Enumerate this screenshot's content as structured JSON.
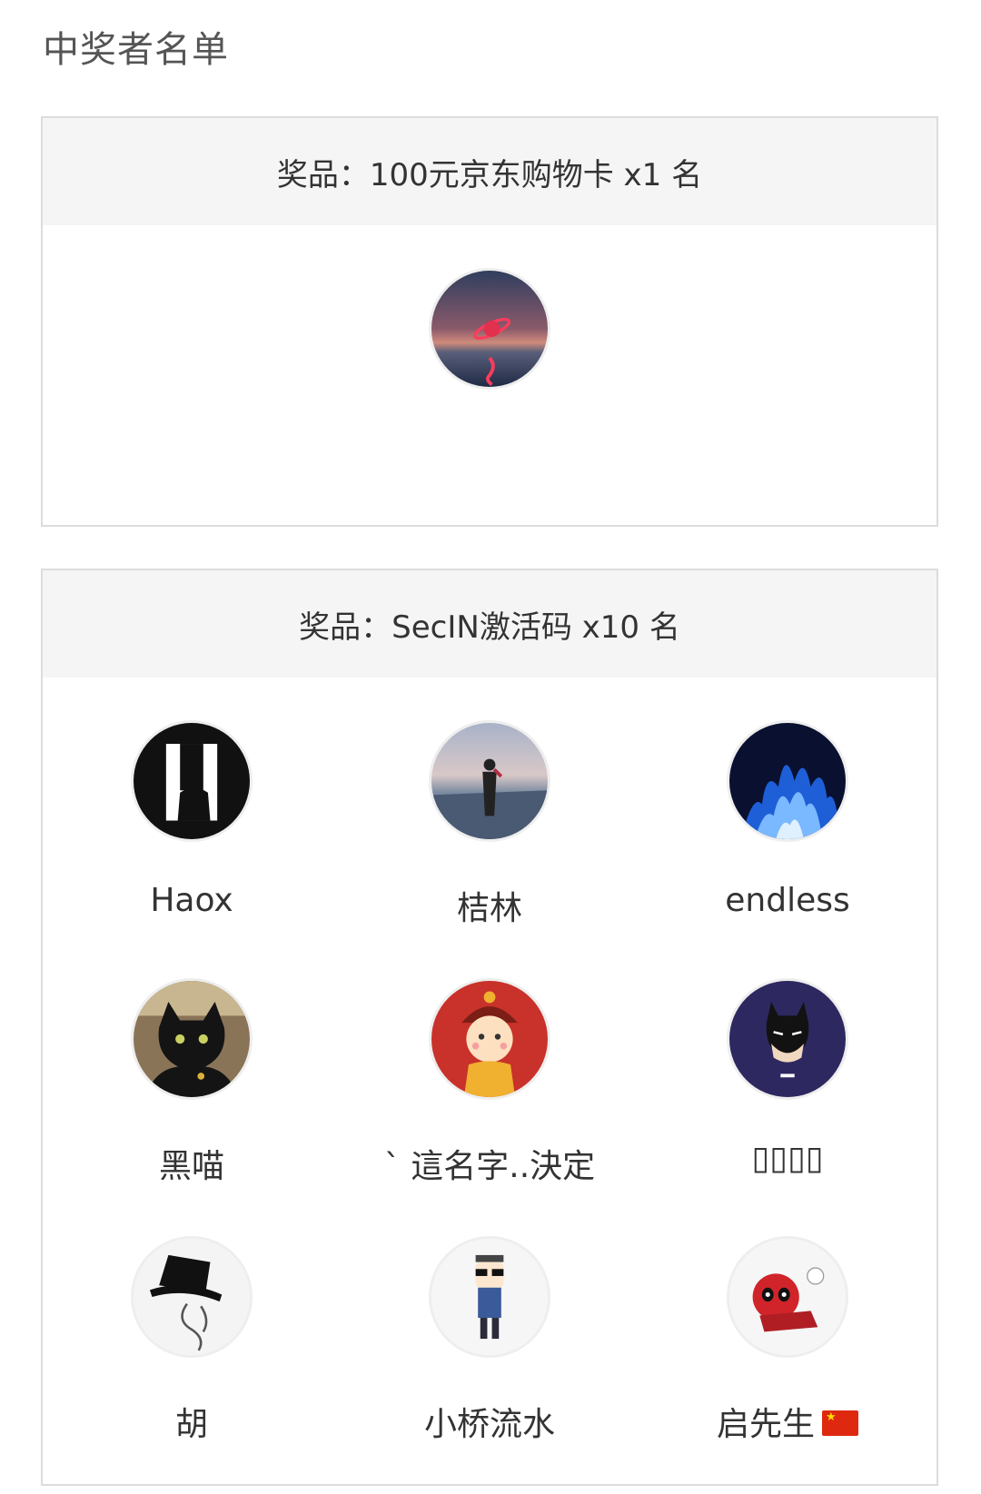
{
  "page": {
    "title": "中奖者名单"
  },
  "prizes": [
    {
      "header": "奖品：100元京东购物卡 x1 名",
      "winners": [
        {
          "name": "",
          "avatar_icon": "planet-ring-avatar"
        }
      ]
    },
    {
      "header": "奖品：SecIN激活码 x10 名",
      "winners": [
        {
          "name": "Haox",
          "avatar_icon": "silhouette-man-avatar"
        },
        {
          "name": "桔林",
          "avatar_icon": "girl-lakeside-avatar"
        },
        {
          "name": "endless",
          "avatar_icon": "blue-flame-avatar"
        },
        {
          "name": "黑喵",
          "avatar_icon": "black-cat-avatar"
        },
        {
          "name": "ˋ  這名字..決定",
          "avatar_icon": "cartoon-kid-avatar"
        },
        {
          "name": "▯▯▯▯",
          "avatar_icon": "batman-avatar"
        },
        {
          "name": "胡",
          "avatar_icon": "top-hat-avatar"
        },
        {
          "name": "小桥流水",
          "avatar_icon": "cartoon-sunglasses-avatar"
        },
        {
          "name": "启先生",
          "avatar_icon": "deadpool-avatar",
          "badge_icon": "china-flag-icon"
        }
      ]
    }
  ]
}
